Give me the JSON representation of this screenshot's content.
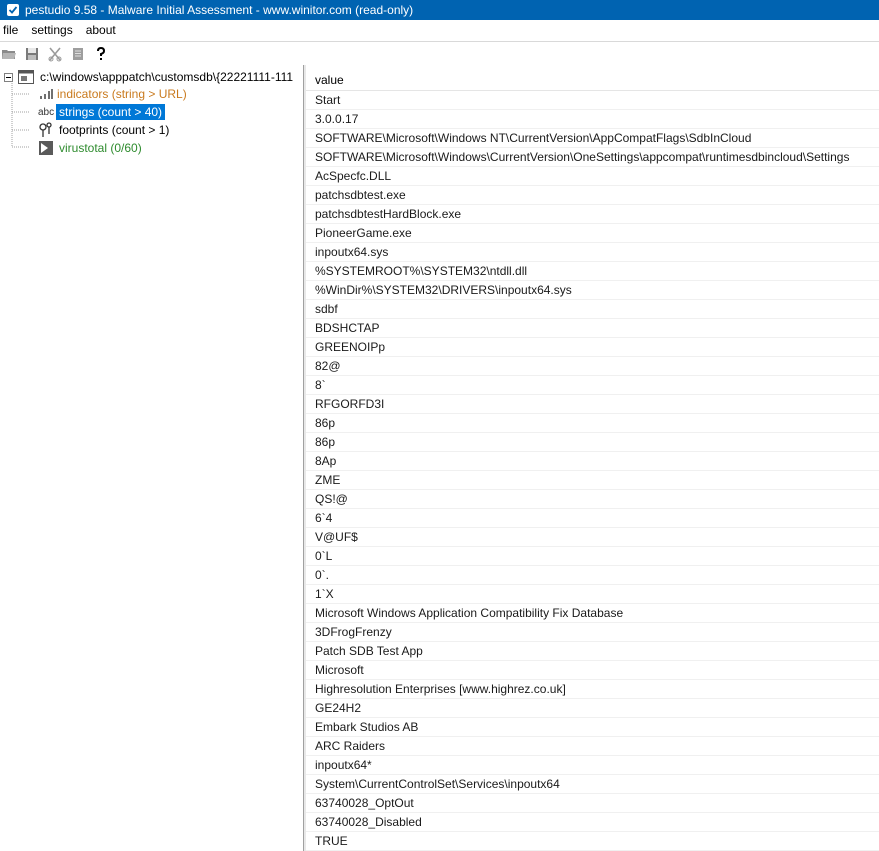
{
  "window": {
    "title": "pestudio 9.58 - Malware Initial Assessment - www.winitor.com (read-only)",
    "titlebar_color": "#0063b1"
  },
  "menu": {
    "items": [
      "file",
      "settings",
      "about"
    ]
  },
  "toolbar": {
    "buttons": [
      "open-folder-icon",
      "save-icon",
      "cut-icon",
      "document-icon",
      "help-icon"
    ]
  },
  "tree": {
    "root": "c:\\windows\\apppatch\\customsdb\\{22221111-111",
    "indicators": "indicators (string > URL)",
    "strings_icon_text": "abc",
    "strings": "strings (count > 40)",
    "footprints": "footprints (count > 1)",
    "virustotal": "virustotal (0/60)",
    "colors": {
      "indicators": "#c97a1e",
      "virustotal": "#2e8b2e",
      "selected": "#0078d7"
    }
  },
  "list": {
    "column_header": "value",
    "rows": [
      "Start",
      "3.0.0.17",
      "SOFTWARE\\Microsoft\\Windows NT\\CurrentVersion\\AppCompatFlags\\SdbInCloud",
      "SOFTWARE\\Microsoft\\Windows\\CurrentVersion\\OneSettings\\appcompat\\runtimesdbincloud\\Settings",
      "AcSpecfc.DLL",
      "patchsdbtest.exe",
      "patchsdbtestHardBlock.exe",
      "PioneerGame.exe",
      "inpoutx64.sys",
      "%SYSTEMROOT%\\SYSTEM32\\ntdll.dll",
      "%WinDir%\\SYSTEM32\\DRIVERS\\inpoutx64.sys",
      "sdbf",
      "BDSHCTAP",
      "GREENOIPp",
      "82@",
      "8`",
      "RFGORFD3I",
      "86p",
      "86p",
      "8Ap",
      "ZME",
      "QS!@",
      "6`4",
      "V@UF$",
      "0`L",
      "0`.",
      "1`X",
      "Microsoft Windows Application Compatibility Fix Database",
      "3DFrogFrenzy",
      "Patch SDB Test App",
      "Microsoft",
      "Highresolution Enterprises [www.highrez.co.uk]",
      "GE24H2",
      "Embark Studios AB",
      "ARC Raiders",
      "inpoutx64*",
      "System\\CurrentControlSet\\Services\\inpoutx64",
      "63740028_OptOut",
      "63740028_Disabled",
      "TRUE"
    ]
  }
}
